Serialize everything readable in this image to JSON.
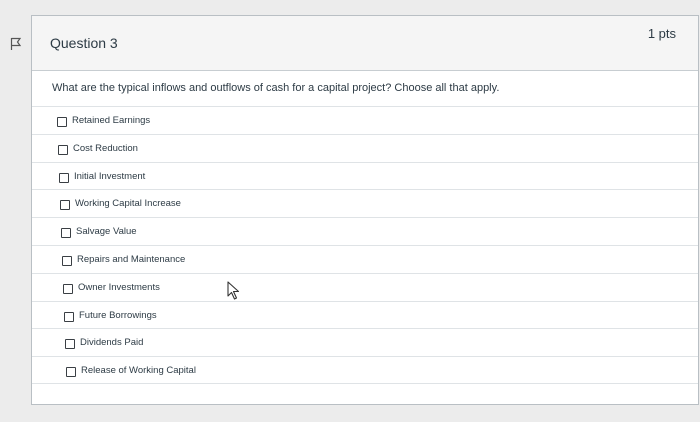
{
  "question": {
    "title": "Question 3",
    "points": "1 pts",
    "prompt": "What are the typical inflows and outflows of cash for a capital project? Choose all that apply."
  },
  "answers": [
    {
      "label": "Retained Earnings"
    },
    {
      "label": "Cost Reduction"
    },
    {
      "label": "Initial Investment"
    },
    {
      "label": "Working Capital Increase"
    },
    {
      "label": "Salvage Value"
    },
    {
      "label": "Repairs and Maintenance"
    },
    {
      "label": "Owner Investments"
    },
    {
      "label": "Future Borrowings"
    },
    {
      "label": "Dividends Paid"
    },
    {
      "label": "Release of Working Capital"
    }
  ],
  "icons": {
    "flag": "flag-icon",
    "cursor": "mouse-pointer-icon"
  }
}
